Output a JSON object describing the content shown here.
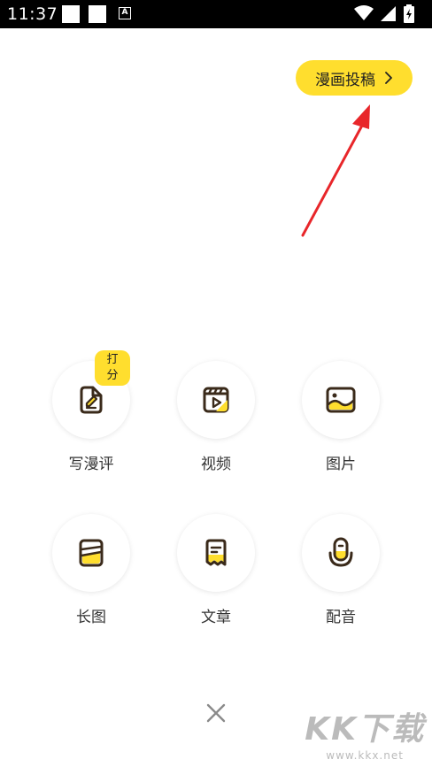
{
  "status_bar": {
    "time": "11:37",
    "notification_icon_letter": "A"
  },
  "header": {
    "submit_label": "漫画投稿"
  },
  "menu": {
    "items": [
      {
        "label": "写漫评",
        "icon": "pencil-doc-icon",
        "badge": "打分"
      },
      {
        "label": "视频",
        "icon": "video-clapper-icon"
      },
      {
        "label": "图片",
        "icon": "picture-icon"
      },
      {
        "label": "长图",
        "icon": "long-image-icon"
      },
      {
        "label": "文章",
        "icon": "article-icon"
      },
      {
        "label": "配音",
        "icon": "microphone-icon"
      }
    ]
  },
  "watermark": {
    "main": "KK下载",
    "sub": "www.kkx.net"
  },
  "colors": {
    "accent": "#ffde2e",
    "icon_stroke": "#3a2a1a",
    "annotation_arrow": "#e8262a"
  }
}
